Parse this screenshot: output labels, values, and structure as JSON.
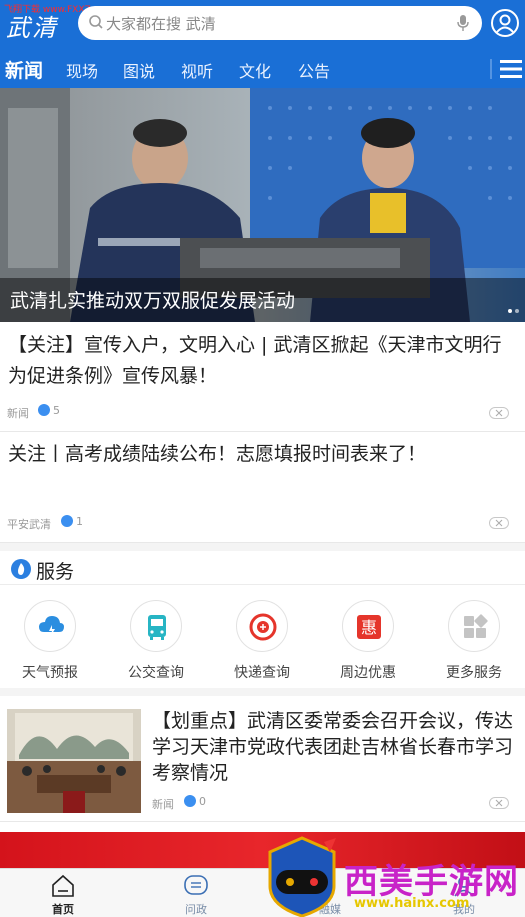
{
  "header": {
    "logo": "武清",
    "watermark": "飞翔下载 www.FXXZ.com",
    "search_placeholder": "大家都在搜 武清"
  },
  "tabs": [
    "新闻",
    "现场",
    "图说",
    "视听",
    "文化",
    "公告"
  ],
  "banner": {
    "title": "武清扎实推动双万双服促发展活动"
  },
  "news": [
    {
      "title": "【关注】宣传入户，文明入心 | 武清区掀起《天津市文明行为促进条例》宣传风暴！",
      "source": "新闻",
      "likes": "5"
    },
    {
      "title": "关注丨高考成绩陆续公布！志愿填报时间表来了！",
      "source": "平安武清",
      "likes": "1"
    }
  ],
  "service": {
    "title": "服务",
    "items": [
      {
        "label": "天气预报",
        "icon": "weather-icon",
        "color": "#2b8ee0"
      },
      {
        "label": "公交查询",
        "icon": "bus-icon",
        "color": "#27b5c4"
      },
      {
        "label": "快递查询",
        "icon": "express-icon",
        "color": "#e5352b"
      },
      {
        "label": "周边优惠",
        "icon": "discount-icon",
        "color": "#e5352b"
      },
      {
        "label": "更多服务",
        "icon": "more-services-icon",
        "color": "#b5b5b5"
      }
    ]
  },
  "article": {
    "title": "【划重点】武清区委常委会召开会议，传达学习天津市党政代表团赴吉林省长春市学习考察情况",
    "source": "新闻",
    "likes": "0"
  },
  "bottom_nav": [
    {
      "label": "首页",
      "icon": "home-icon"
    },
    {
      "label": "问政",
      "icon": "message-icon"
    },
    {
      "label": "融媒",
      "icon": "media-icon"
    },
    {
      "label": "我的",
      "icon": "profile-icon"
    }
  ],
  "overlay_watermark": {
    "text": "西美手游网",
    "url": "www.hainx.com"
  },
  "colors": {
    "primary": "#1a6fd6",
    "accent_red": "#e5352b"
  }
}
